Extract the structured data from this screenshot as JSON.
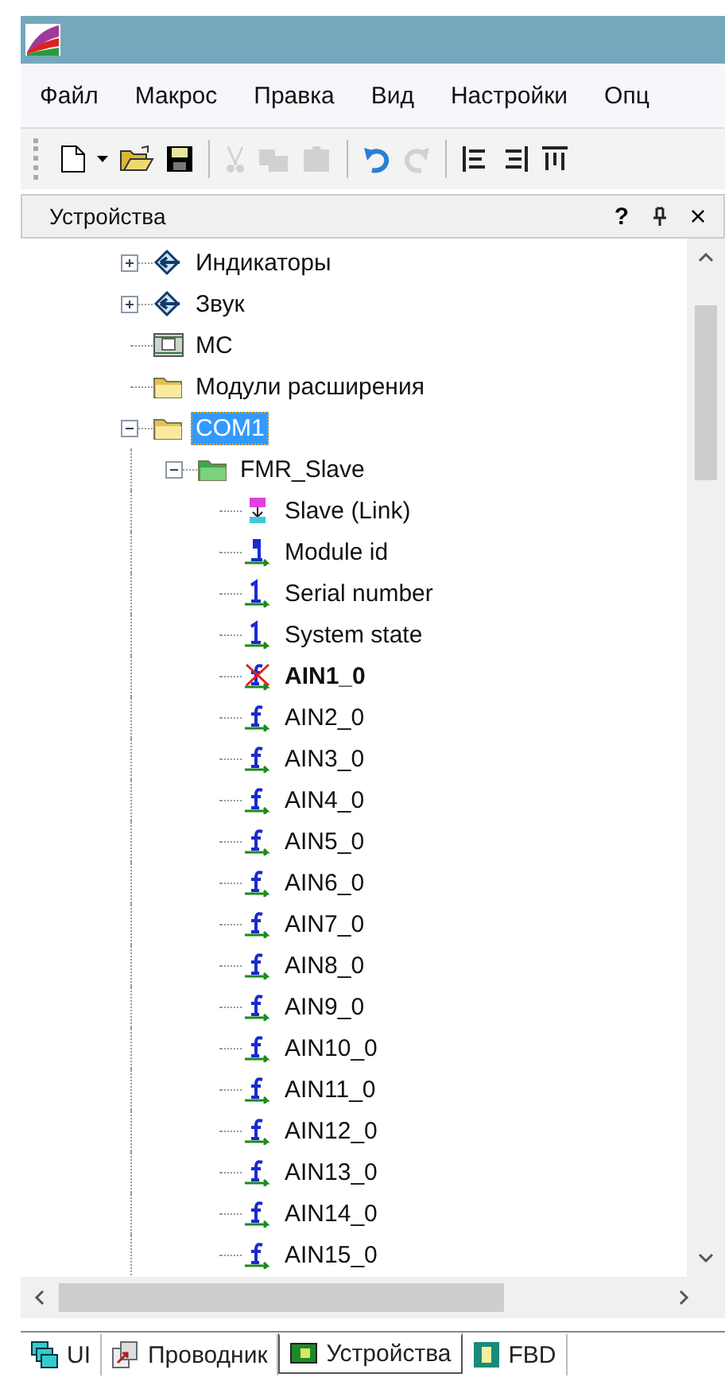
{
  "menu": [
    "Файл",
    "Макрос",
    "Правка",
    "Вид",
    "Настройки",
    "Опц"
  ],
  "toolbar": [
    {
      "kind": "new",
      "disabled": false
    },
    {
      "kind": "dropdown",
      "disabled": false
    },
    {
      "kind": "open",
      "disabled": false
    },
    {
      "kind": "save",
      "disabled": false
    },
    {
      "kind": "sep"
    },
    {
      "kind": "cut",
      "disabled": true
    },
    {
      "kind": "copy",
      "disabled": true
    },
    {
      "kind": "paste",
      "disabled": true
    },
    {
      "kind": "sep"
    },
    {
      "kind": "undo",
      "disabled": false
    },
    {
      "kind": "redo",
      "disabled": true
    },
    {
      "kind": "sep"
    },
    {
      "kind": "align-left",
      "disabled": false
    },
    {
      "kind": "align-right",
      "disabled": false
    },
    {
      "kind": "align-top",
      "disabled": false
    }
  ],
  "panel": {
    "title": "Устройства",
    "help": "?",
    "close": "×"
  },
  "tree": [
    {
      "label": "Индикаторы",
      "kind": "indicator",
      "expanded": false,
      "selected": false,
      "bold": false
    },
    {
      "label": "Звук",
      "kind": "indicator",
      "expanded": false,
      "selected": false,
      "bold": false
    },
    {
      "label": "МС",
      "kind": "device",
      "selected": false,
      "bold": false
    },
    {
      "label": "Модули расширения",
      "kind": "folder",
      "selected": false,
      "bold": false
    },
    {
      "label": "COM1",
      "kind": "folder",
      "expanded": true,
      "selected": true,
      "bold": false,
      "children": [
        {
          "label": "FMR_Slave",
          "kind": "module",
          "expanded": true,
          "selected": false,
          "bold": false,
          "children": [
            {
              "label": "Slave (Link)",
              "kind": "link",
              "selected": false,
              "bold": false
            },
            {
              "label": "Module id",
              "kind": "info",
              "selected": false,
              "bold": false
            },
            {
              "label": "Serial number",
              "kind": "integer",
              "selected": false,
              "bold": false
            },
            {
              "label": "System state",
              "kind": "integer",
              "selected": false,
              "bold": false
            },
            {
              "label": "AIN1_0",
              "kind": "float-error",
              "selected": false,
              "bold": true
            },
            {
              "label": "AIN2_0",
              "kind": "float",
              "selected": false,
              "bold": false
            },
            {
              "label": "AIN3_0",
              "kind": "float",
              "selected": false,
              "bold": false
            },
            {
              "label": "AIN4_0",
              "kind": "float",
              "selected": false,
              "bold": false
            },
            {
              "label": "AIN5_0",
              "kind": "float",
              "selected": false,
              "bold": false
            },
            {
              "label": "AIN6_0",
              "kind": "float",
              "selected": false,
              "bold": false
            },
            {
              "label": "AIN7_0",
              "kind": "float",
              "selected": false,
              "bold": false
            },
            {
              "label": "AIN8_0",
              "kind": "float",
              "selected": false,
              "bold": false
            },
            {
              "label": "AIN9_0",
              "kind": "float",
              "selected": false,
              "bold": false
            },
            {
              "label": "AIN10_0",
              "kind": "float",
              "selected": false,
              "bold": false
            },
            {
              "label": "AIN11_0",
              "kind": "float",
              "selected": false,
              "bold": false
            },
            {
              "label": "AIN12_0",
              "kind": "float",
              "selected": false,
              "bold": false
            },
            {
              "label": "AIN13_0",
              "kind": "float",
              "selected": false,
              "bold": false
            },
            {
              "label": "AIN14_0",
              "kind": "float",
              "selected": false,
              "bold": false
            },
            {
              "label": "AIN15_0",
              "kind": "float",
              "selected": false,
              "bold": false
            }
          ]
        }
      ]
    }
  ],
  "tabs": [
    {
      "label": "UI",
      "kind": "ui",
      "selected": false
    },
    {
      "label": "Проводник",
      "kind": "explorer",
      "selected": false
    },
    {
      "label": "Устройства",
      "kind": "devices",
      "selected": true
    },
    {
      "label": "FBD",
      "kind": "fbd",
      "selected": false
    }
  ]
}
